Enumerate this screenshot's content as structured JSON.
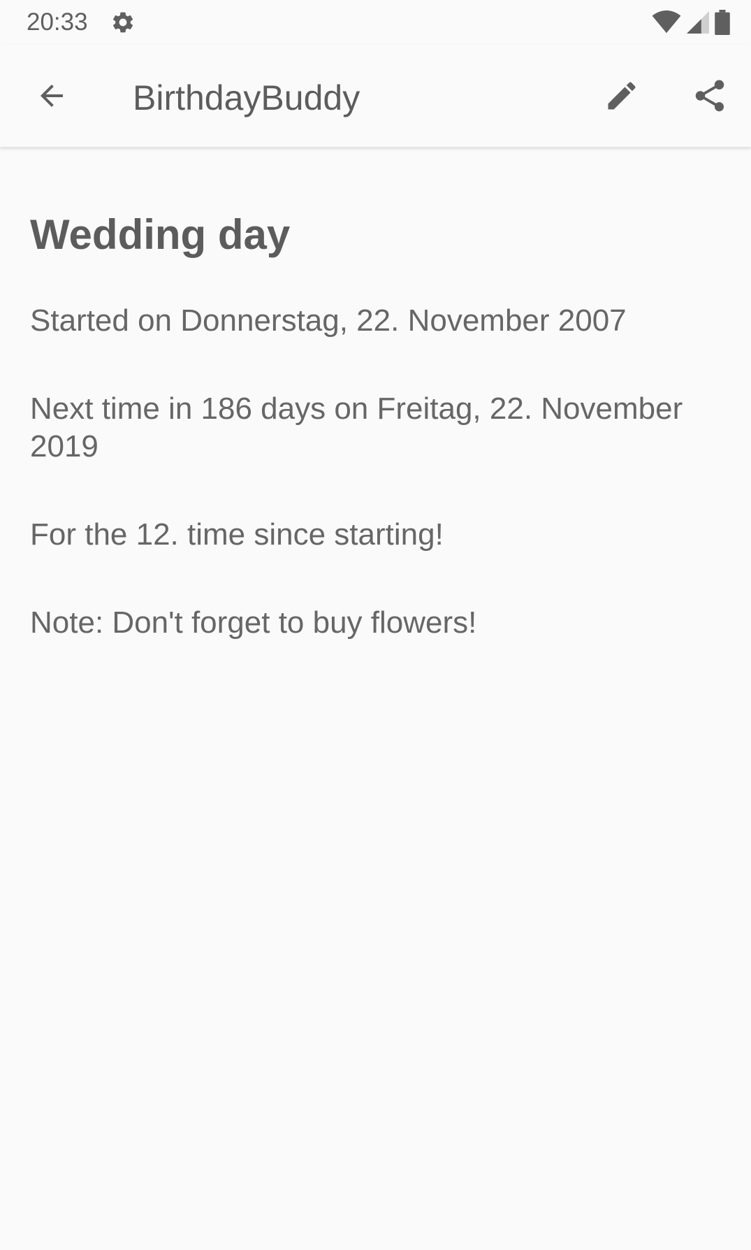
{
  "status_bar": {
    "time": "20:33",
    "icons": [
      "gear-icon",
      "wifi-icon",
      "signal-icon",
      "battery-icon"
    ]
  },
  "app_bar": {
    "title": "BirthdayBuddy",
    "icons": [
      "arrow-back-icon",
      "pencil-icon",
      "share-icon"
    ]
  },
  "event": {
    "title": "Wedding day",
    "started": "Started on Donnerstag, 22. November 2007",
    "next": "Next time in 186 days on Freitag, 22. November 2019",
    "count": "For the 12. time since starting!",
    "note": "Note: Don't forget to buy flowers!"
  },
  "colors": {
    "background": "#fafafa",
    "text": "#616161",
    "icon": "#5f5f5f"
  }
}
